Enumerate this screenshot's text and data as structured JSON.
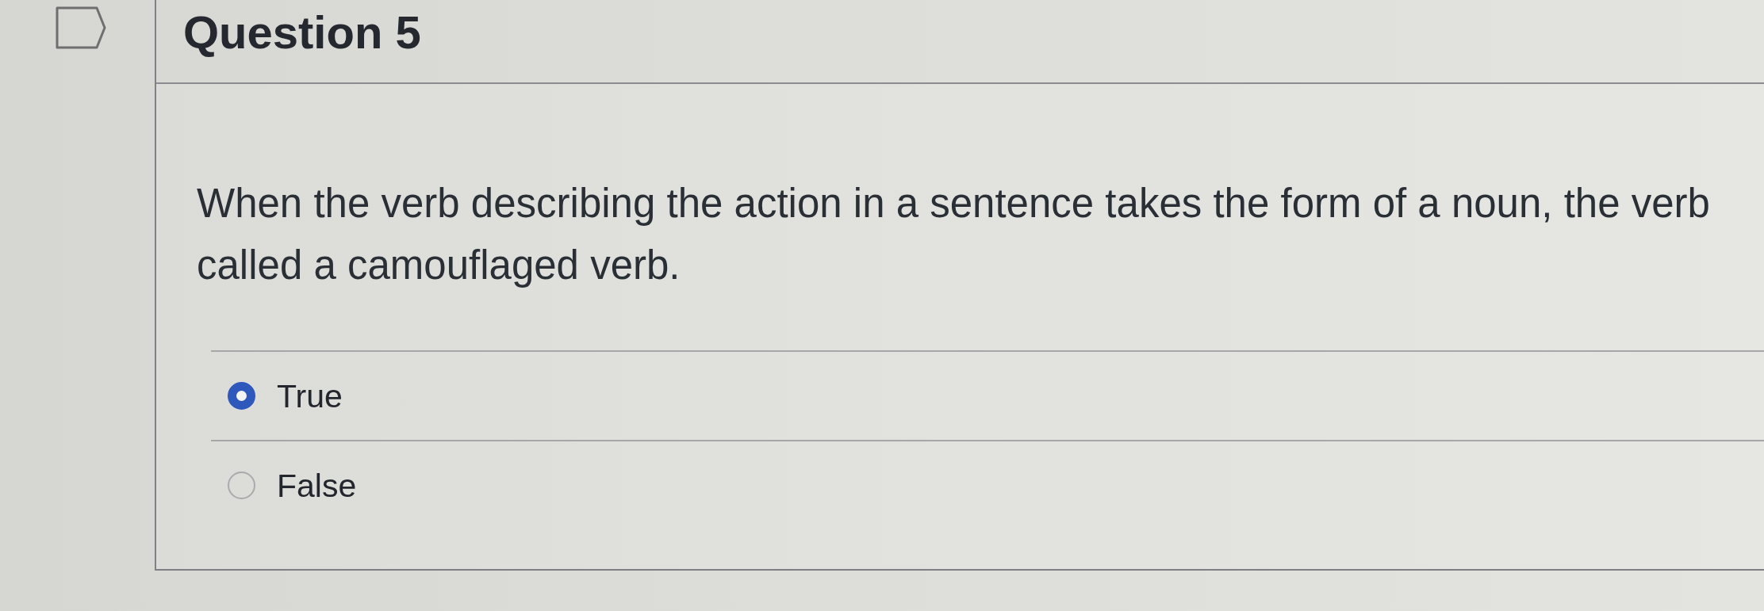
{
  "question": {
    "flagged": false,
    "title": "Question 5",
    "text_lines": [
      "When the verb describing the action in a sentence takes the form of a noun, the verb",
      "called a camouflaged verb."
    ],
    "answers": [
      {
        "label": "True",
        "selected": true
      },
      {
        "label": "False",
        "selected": false
      }
    ]
  }
}
